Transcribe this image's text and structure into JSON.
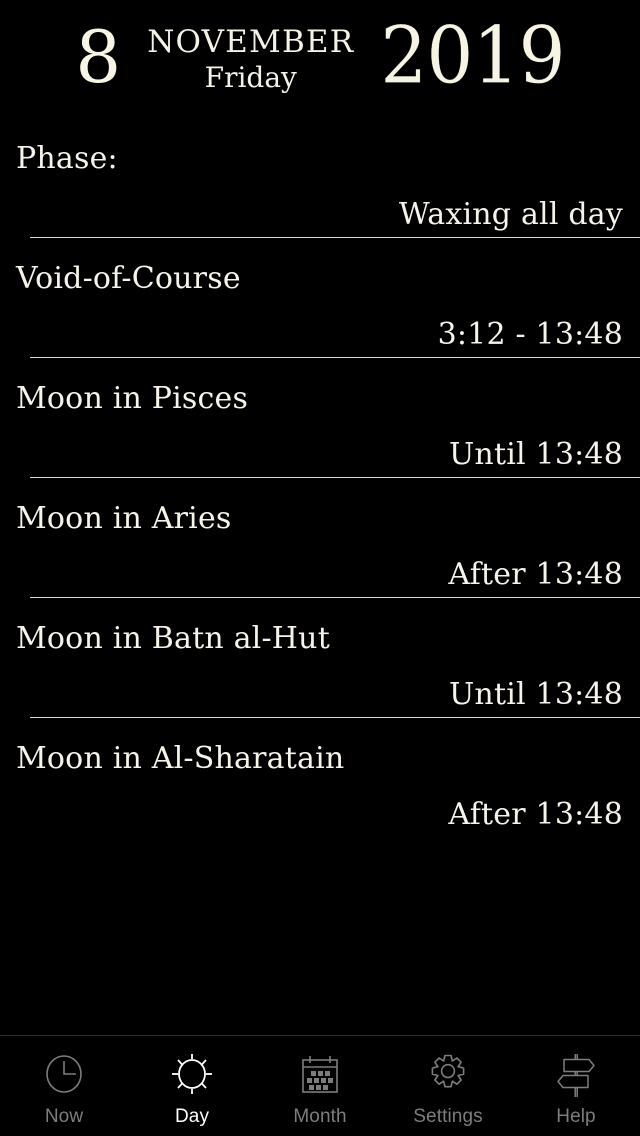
{
  "header": {
    "day": "8",
    "month": "NOVEMBER",
    "weekday": "Friday",
    "year": "2019"
  },
  "rows": [
    {
      "title": "Phase:",
      "value": "Waxing all day"
    },
    {
      "title": "Void-of-Course",
      "value": "3:12 - 13:48"
    },
    {
      "title": "Moon in Pisces",
      "value": "Until 13:48"
    },
    {
      "title": "Moon in Aries",
      "value": "After 13:48"
    },
    {
      "title": "Moon in Batn al-Hut",
      "value": "Until 13:48"
    },
    {
      "title": "Moon in Al-Sharatain",
      "value": "After 13:48"
    }
  ],
  "tabbar": {
    "active": "Day",
    "items": [
      {
        "label": "Now",
        "icon": "clock-icon"
      },
      {
        "label": "Day",
        "icon": "sun-icon"
      },
      {
        "label": "Month",
        "icon": "calendar-icon"
      },
      {
        "label": "Settings",
        "icon": "gear-icon"
      },
      {
        "label": "Help",
        "icon": "signpost-icon"
      }
    ]
  },
  "colors": {
    "background": "#000000",
    "text": "#f6f4ea",
    "accent_cream": "#f7f5e6",
    "divider": "#d8d8d0",
    "tab_inactive": "#7d7d7d",
    "tab_active": "#ffffff"
  }
}
